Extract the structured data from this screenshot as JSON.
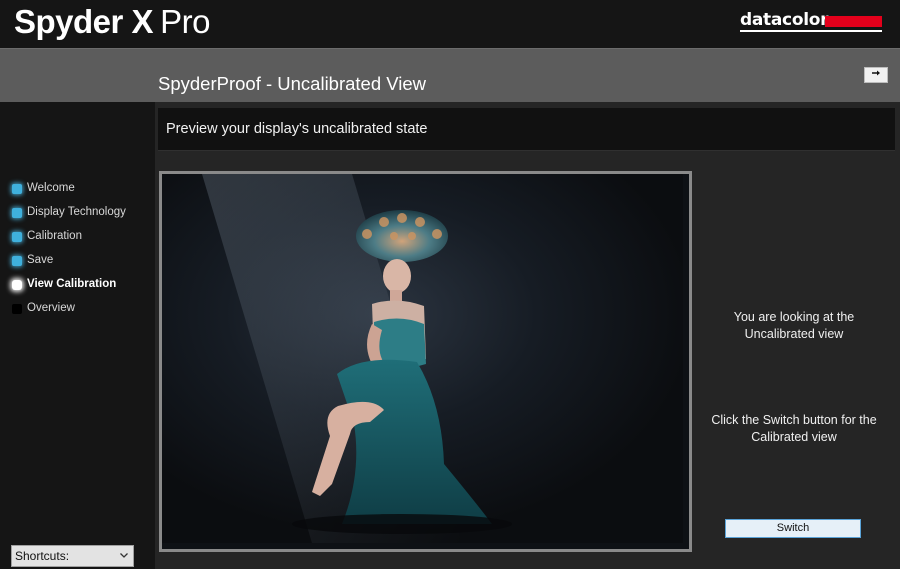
{
  "app": {
    "title_bold": "Spyder X",
    "title_light": "Pro",
    "brand": "datacolor"
  },
  "header": {
    "page_title": "SpyderProof - Uncalibrated View",
    "collapse_icon": "arrow-right-icon"
  },
  "sidebar": {
    "steps": [
      {
        "label": "Welcome",
        "status": "done"
      },
      {
        "label": "Display Technology",
        "status": "done"
      },
      {
        "label": "Calibration",
        "status": "done"
      },
      {
        "label": "Save",
        "status": "done"
      },
      {
        "label": "View Calibration",
        "status": "active"
      },
      {
        "label": "Overview",
        "status": "pending"
      }
    ],
    "shortcuts": {
      "selected": "Shortcuts:"
    }
  },
  "main": {
    "subtitle": "Preview your display's uncalibrated state",
    "preview_image": "peacock-costume-portrait",
    "info_text_1": "You are looking at the Uncalibrated view",
    "info_text_2": "Click the Switch button for the Calibrated view",
    "switch_label": "Switch"
  },
  "colors": {
    "step_done": "#3fb0dc",
    "step_active": "#ffffff",
    "brand_red": "#e4001b",
    "title_band": "#5c5c5c"
  }
}
